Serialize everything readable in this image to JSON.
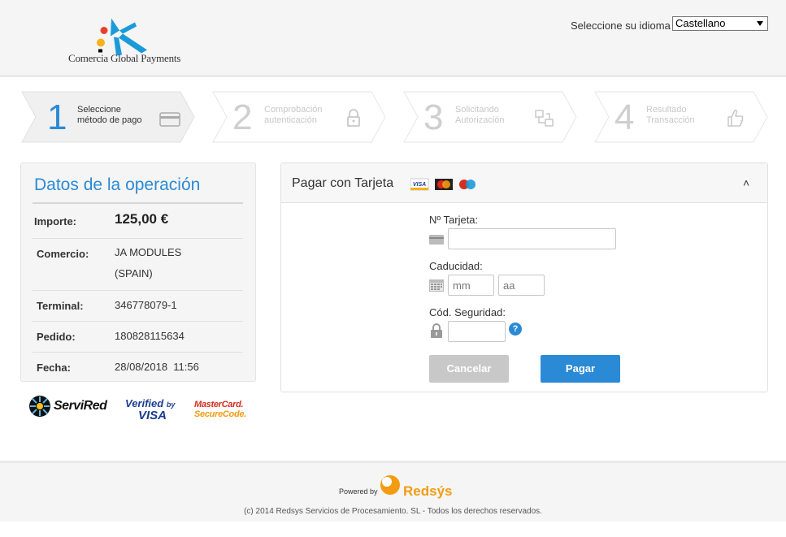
{
  "header": {
    "brand": "Comercia Global Payments",
    "language_label": "Seleccione su idioma",
    "language_selected": "Castellano"
  },
  "steps": [
    {
      "number": "1",
      "line1": "Seleccione",
      "line2": "método de pago",
      "state": "active",
      "icon": "credit-card-icon"
    },
    {
      "number": "2",
      "line1": "Comprobación",
      "line2": "autenticación",
      "state": "inactive",
      "icon": "lock-icon"
    },
    {
      "number": "3",
      "line1": "Solicitando",
      "line2": "Autorización",
      "state": "inactive",
      "icon": "network-icon"
    },
    {
      "number": "4",
      "line1": "Resultado",
      "line2": "Transacción",
      "state": "inactive",
      "icon": "thumbs-up-icon"
    }
  ],
  "operation": {
    "title": "Datos de la operación",
    "rows": [
      {
        "label": "Importe:",
        "value": "125,00 €"
      },
      {
        "label": "Comercio:",
        "value": "JA MODULES",
        "value2": "(SPAIN)"
      },
      {
        "label": "Terminal:",
        "value": "346778079-1"
      },
      {
        "label": "Pedido:",
        "value": "180828115634"
      },
      {
        "label": "Fecha:",
        "value": "28/08/2018  11:56"
      }
    ]
  },
  "brands": {
    "servired": "ServiRed",
    "verified_line1": "Verified",
    "verified_by": "by",
    "verified_line2": "VISA",
    "mastercard_line1": "MasterCard.",
    "mastercard_line2": "SecureCode."
  },
  "card_form": {
    "title": "Pagar con Tarjeta",
    "card_number_label": "Nº Tarjeta:",
    "card_number_value": "",
    "expiry_label": "Caducidad:",
    "month_placeholder": "mm",
    "year_placeholder": "aa",
    "cvv_label": "Cód. Seguridad:",
    "cvv_value": "",
    "help_symbol": "?",
    "cancel_label": "Cancelar",
    "pay_label": "Pagar",
    "collapse_symbol": "˄",
    "card_logos": [
      "VISA",
      "MasterCard",
      "Maestro"
    ]
  },
  "footer": {
    "powered_by": "Powered by",
    "redsys": "Redsýs",
    "copyright": "(c) 2014 Redsys Servicios de Procesamiento. SL - Todos los derechos reservados."
  },
  "colors": {
    "accent": "#2b8ad6",
    "cancel_button": "#c8c8c8",
    "redsys_orange": "#f39c12"
  }
}
